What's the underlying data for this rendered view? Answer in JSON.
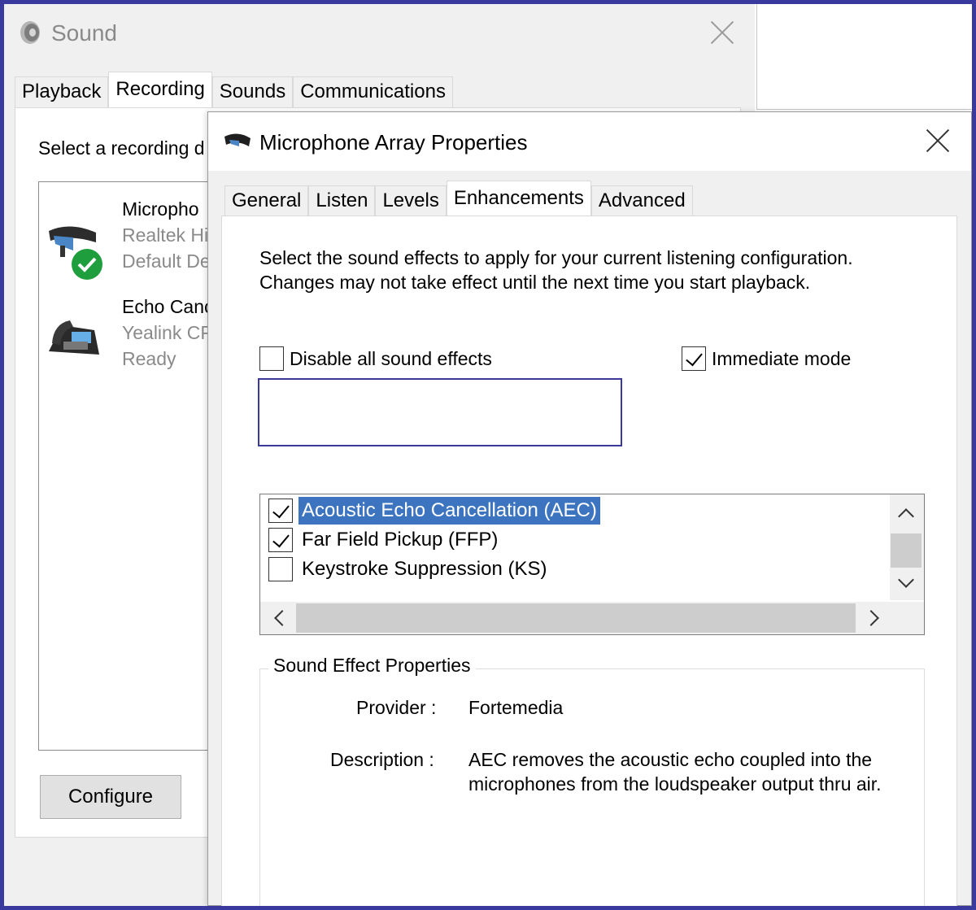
{
  "sound_window": {
    "title": "Sound",
    "tabs": [
      "Playback",
      "Recording",
      "Sounds",
      "Communications"
    ],
    "active_tab": "Recording",
    "instruction": "Select a recording d",
    "devices": [
      {
        "name": "Micropho",
        "line2": "Realtek Hi",
        "line3": "Default De",
        "icon": "headset-microphone-icon",
        "status_icon": "default-device-check-icon"
      },
      {
        "name": "Echo Canc",
        "line2": "Yealink CP",
        "line3": "Ready",
        "icon": "conference-phone-icon"
      }
    ],
    "configure_label": "Configure"
  },
  "properties_dialog": {
    "title": "Microphone Array Properties",
    "tabs": [
      "General",
      "Listen",
      "Levels",
      "Enhancements",
      "Advanced"
    ],
    "active_tab": "Enhancements",
    "description_line1": "Select the sound effects to apply for your current listening configuration.",
    "description_line2": "Changes may not take effect until the next time you start playback.",
    "disable_all": {
      "label": "Disable all sound effects",
      "checked": false
    },
    "immediate_mode": {
      "label": "Immediate mode",
      "checked": true
    },
    "effects": [
      {
        "label": "Acoustic Echo Cancellation (AEC)",
        "checked": true,
        "selected": true
      },
      {
        "label": "Far Field Pickup (FFP)",
        "checked": true,
        "selected": false
      },
      {
        "label": "Keystroke Suppression (KS)",
        "checked": false,
        "selected": false
      }
    ],
    "sound_effect_properties": {
      "title": "Sound Effect Properties",
      "provider_label": "Provider :",
      "provider_value": "Fortemedia",
      "description_label": "Description :",
      "description_value": "AEC removes the acoustic echo coupled into the microphones from the loudspeaker output thru air."
    }
  },
  "colors": {
    "frame_border": "#3a3a9e",
    "selection": "#3c74c0",
    "check_badge": "#1e9e3c"
  }
}
